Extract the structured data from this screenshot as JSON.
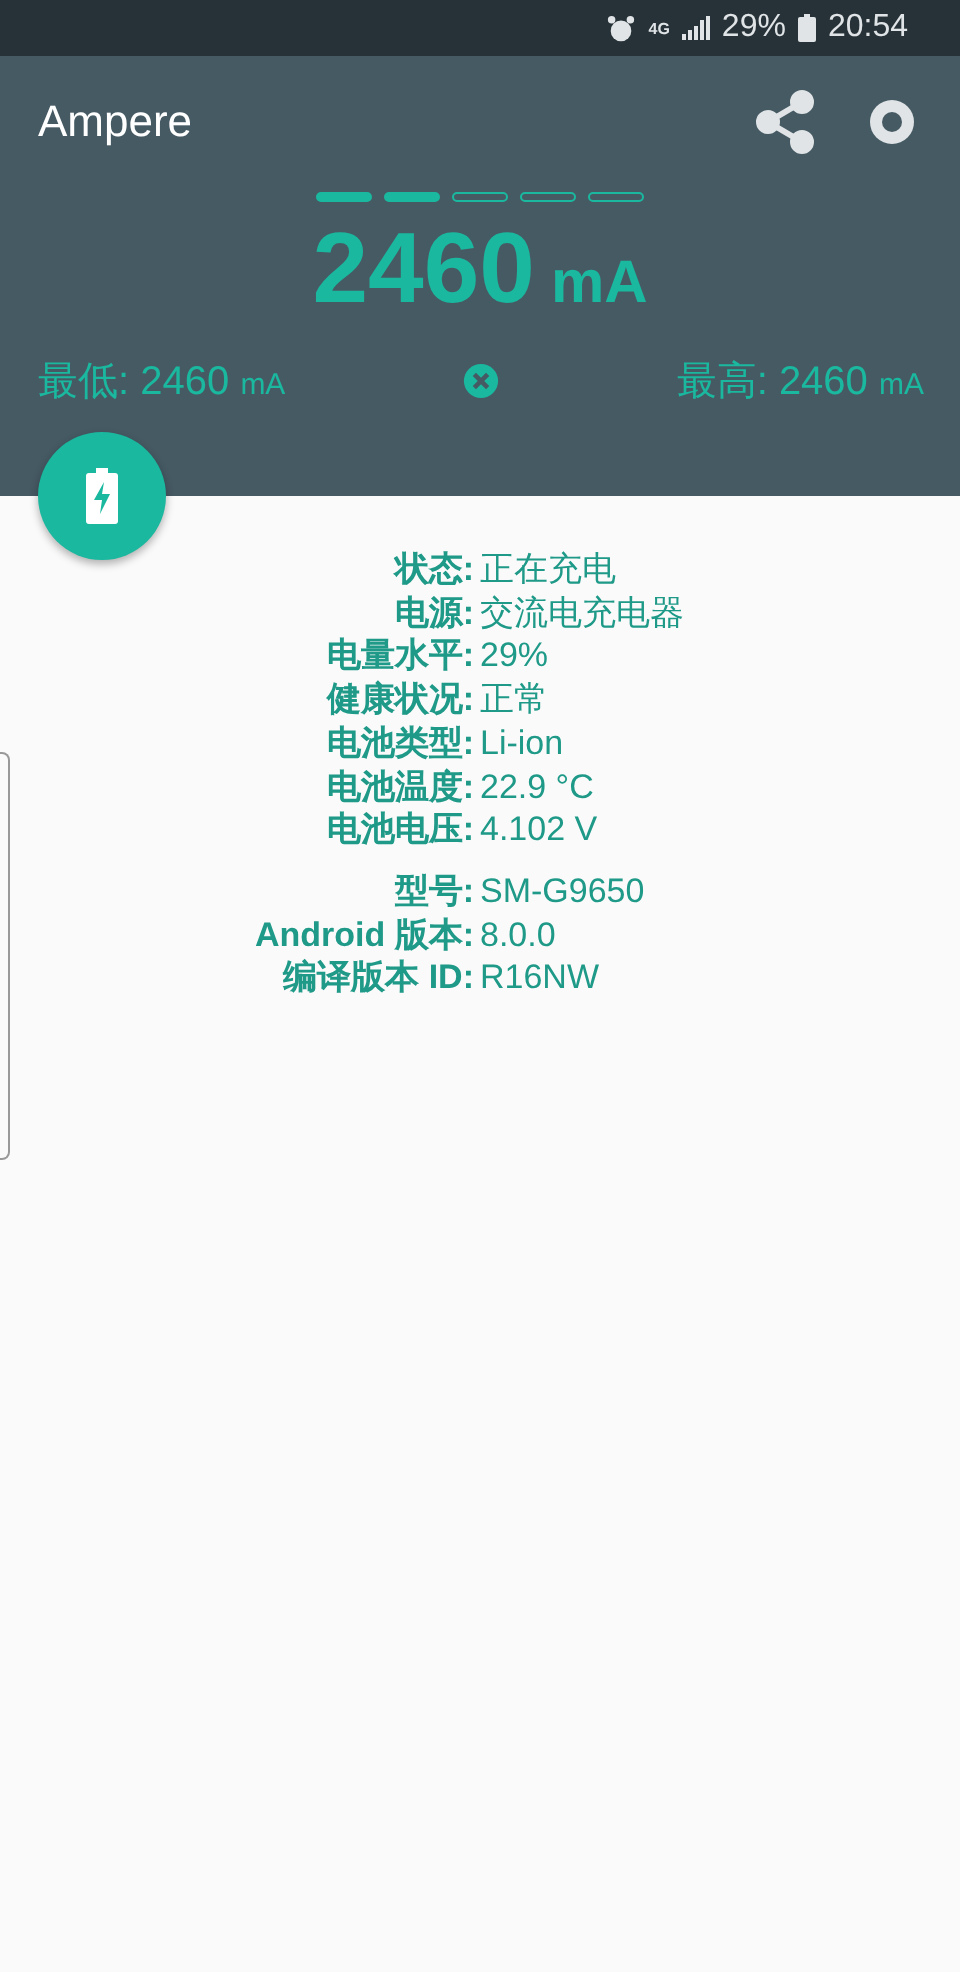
{
  "status_bar": {
    "network": "4G",
    "battery": "29%",
    "time": "20:54"
  },
  "app_bar": {
    "title": "Ampere"
  },
  "indicators": [
    {
      "filled": true
    },
    {
      "filled": true
    },
    {
      "filled": false
    },
    {
      "filled": false
    },
    {
      "filled": false
    }
  ],
  "current": {
    "value": "2460",
    "unit": "mA"
  },
  "min": {
    "label": "最低:",
    "value": "2460",
    "unit": "mA"
  },
  "max": {
    "label": "最高:",
    "value": "2460",
    "unit": "mA"
  },
  "groups": [
    {
      "rows": [
        {
          "label": "状态:",
          "value": "正在充电"
        },
        {
          "label": "电源:",
          "value": "交流电充电器"
        },
        {
          "label": "电量水平:",
          "value": "29%"
        },
        {
          "label": "健康状况:",
          "value": "正常"
        },
        {
          "label": "电池类型:",
          "value": "Li-ion"
        },
        {
          "label": "电池温度:",
          "value": "22.9 °C"
        },
        {
          "label": "电池电压:",
          "value": "4.102 V"
        }
      ]
    },
    {
      "rows": [
        {
          "label": "型号:",
          "value": "SM-G9650"
        },
        {
          "label": "Android 版本:",
          "value": "8.0.0"
        },
        {
          "label": "编译版本 ID:",
          "value": "R16NW"
        }
      ]
    }
  ]
}
